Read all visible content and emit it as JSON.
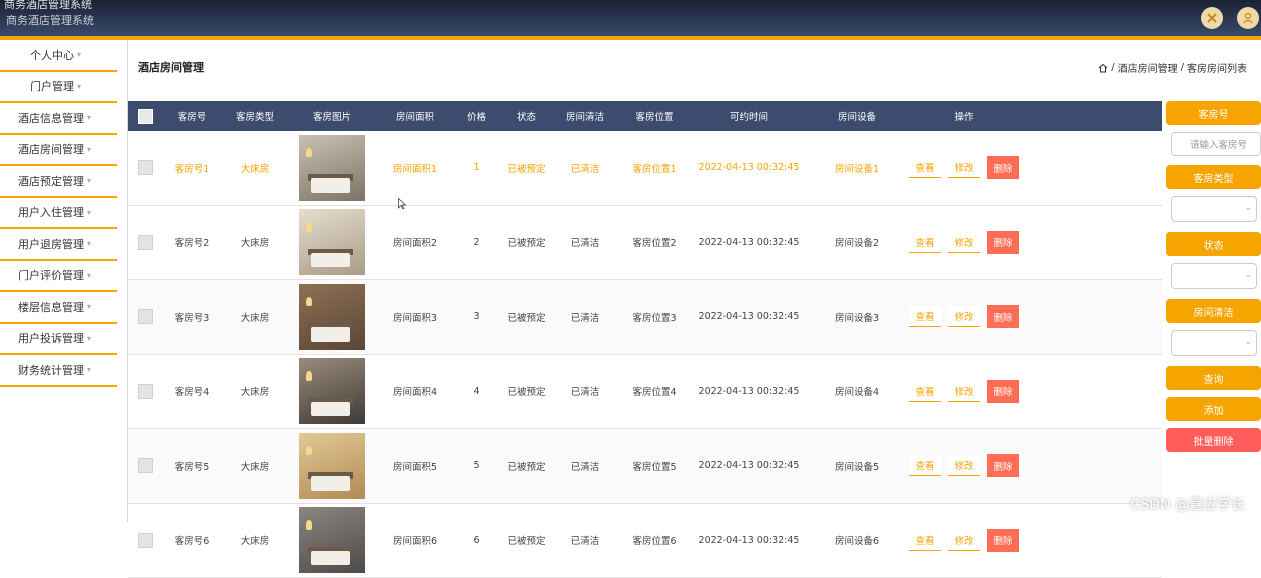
{
  "header": {
    "title_top": "商务酒店管理系统",
    "title": "商务酒店管理系统",
    "icons": [
      "settings-icon",
      "user-icon"
    ]
  },
  "sidebar": {
    "items": [
      {
        "label": "个人中心"
      },
      {
        "label": "门户管理"
      },
      {
        "label": "酒店信息管理"
      },
      {
        "label": "酒店房间管理"
      },
      {
        "label": "酒店预定管理"
      },
      {
        "label": "用户入住管理"
      },
      {
        "label": "用户退房管理"
      },
      {
        "label": "门户评价管理"
      },
      {
        "label": "楼层信息管理"
      },
      {
        "label": "用户投诉管理"
      },
      {
        "label": "财务统计管理"
      }
    ]
  },
  "page": {
    "title": "酒店房间管理",
    "breadcrumb": [
      "酒店房间管理",
      "客房房间列表"
    ]
  },
  "table": {
    "headers": [
      "客房号",
      "客房类型",
      "客房图片",
      "房间面积",
      "价格",
      "状态",
      "房间清洁",
      "客房位置",
      "可约时间",
      "房间设备",
      "操作"
    ],
    "rows": [
      {
        "room_no": "客房号1",
        "type": "大床房",
        "area": "房间面积1",
        "price": "1",
        "status": "已被预定",
        "clean": "已清洁",
        "location": "客房位置1",
        "time": "2022-04-13 00:32:45",
        "equipment": "房间设备1",
        "highlight": true
      },
      {
        "room_no": "客房号2",
        "type": "大床房",
        "area": "房间面积2",
        "price": "2",
        "status": "已被预定",
        "clean": "已清洁",
        "location": "客房位置2",
        "time": "2022-04-13 00:32:45",
        "equipment": "房间设备2",
        "highlight": false
      },
      {
        "room_no": "客房号3",
        "type": "大床房",
        "area": "房间面积3",
        "price": "3",
        "status": "已被预定",
        "clean": "已清洁",
        "location": "客房位置3",
        "time": "2022-04-13 00:32:45",
        "equipment": "房间设备3",
        "highlight": false
      },
      {
        "room_no": "客房号4",
        "type": "大床房",
        "area": "房间面积4",
        "price": "4",
        "status": "已被预定",
        "clean": "已清洁",
        "location": "客房位置4",
        "time": "2022-04-13 00:32:45",
        "equipment": "房间设备4",
        "highlight": false
      },
      {
        "room_no": "客房号5",
        "type": "大床房",
        "area": "房间面积5",
        "price": "5",
        "status": "已被预定",
        "clean": "已清洁",
        "location": "客房位置5",
        "time": "2022-04-13 00:32:45",
        "equipment": "房间设备5",
        "highlight": false
      },
      {
        "room_no": "客房号6",
        "type": "大床房",
        "area": "房间面积6",
        "price": "6",
        "status": "已被预定",
        "clean": "已清洁",
        "location": "客房位置6",
        "time": "2022-04-13 00:32:45",
        "equipment": "房间设备6",
        "highlight": false
      }
    ],
    "actions": {
      "view": "查看",
      "edit": "修改",
      "delete": "删除"
    }
  },
  "search_panel": {
    "room_no_label": "客房号",
    "room_no_placeholder": "请输入客房号",
    "type_label": "客房类型",
    "status_label": "状态",
    "clean_label": "房间清洁",
    "query_button": "查询",
    "add_button": "添加",
    "batch_delete_button": "批量删除"
  },
  "watermark": "CSDN @嘉应学长",
  "colors": {
    "accent": "#f5a400",
    "header_bg": "#2b3852",
    "table_header": "#3b4c6e",
    "danger": "#ff6d55"
  }
}
